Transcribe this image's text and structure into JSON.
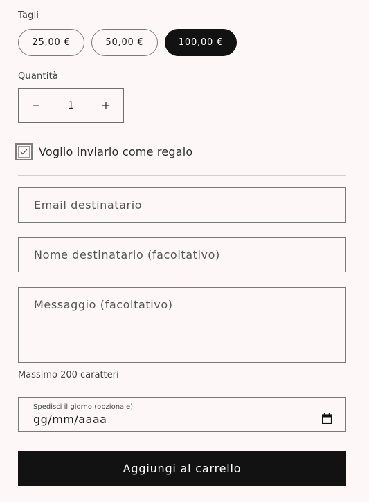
{
  "denominations": {
    "label": "Tagli",
    "options": [
      "25,00 €",
      "50,00 €",
      "100,00 €"
    ],
    "selected": "100,00 €"
  },
  "quantity": {
    "label": "Quantità",
    "value": "1",
    "decrease_symbol": "−",
    "increase_symbol": "+"
  },
  "gift": {
    "checked": true,
    "label": "Voglio inviarlo come regalo"
  },
  "fields": {
    "email_placeholder": "Email destinatario",
    "name_placeholder": "Nome destinatario (facoltativo)",
    "message_placeholder": "Messaggio (facoltativo)",
    "message_hint": "Massimo 200 caratteri"
  },
  "send_date": {
    "label": "Spedisci il giorno (opzionale)",
    "value": "gg/mm/aaaa",
    "icon": "calendar-icon"
  },
  "actions": {
    "add_to_cart": "Aggiungi al carrello"
  }
}
